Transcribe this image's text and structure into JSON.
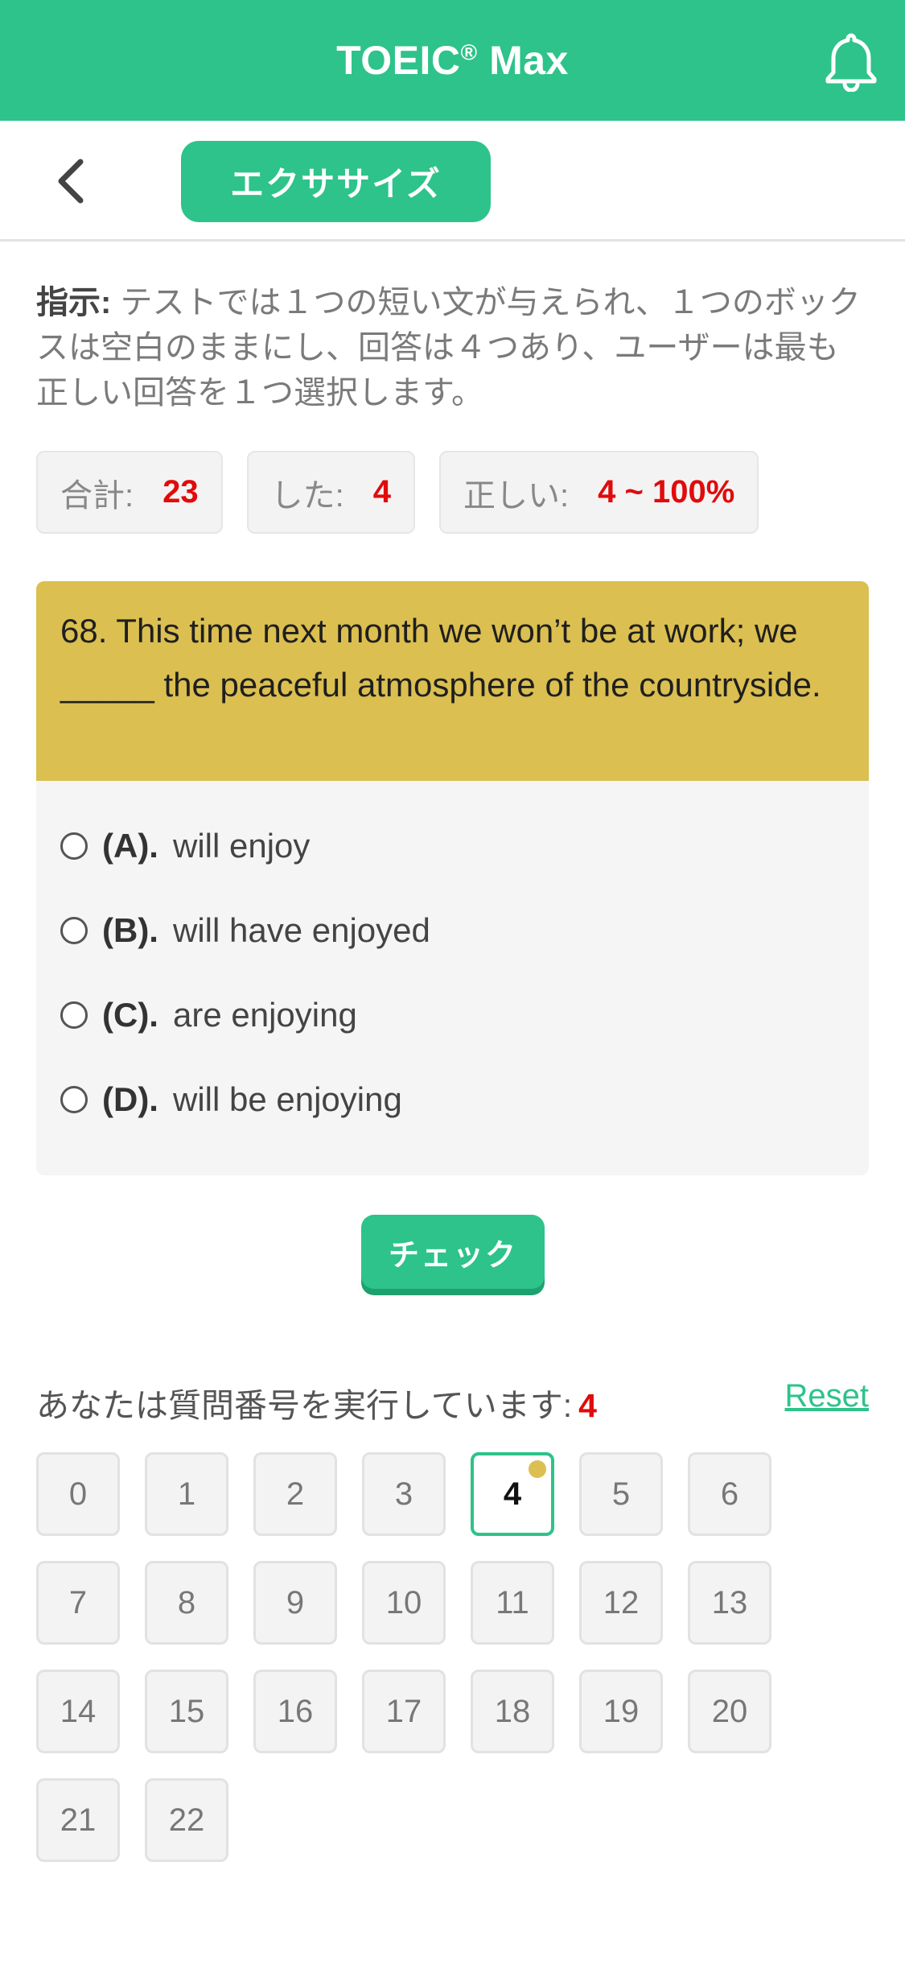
{
  "header": {
    "title": "TOEIC",
    "title_sup": "®",
    "title_suffix": " Max"
  },
  "subheader": {
    "tab_label": "エクササイズ"
  },
  "instruction": {
    "label": "指示:",
    "text": " テストでは１つの短い文が与えられ、１つのボックスは空白のままにし、回答は４つあり、ユーザーは最も正しい回答を１つ選択します。"
  },
  "stats": [
    {
      "label": "合計:",
      "value": "23"
    },
    {
      "label": "した:",
      "value": "4"
    },
    {
      "label": "正しい:",
      "value": "4 ~ 100%"
    }
  ],
  "question": {
    "text": "68. This time next month we won’t be at work; we _____ the peaceful atmosphere of the countryside.",
    "options": [
      {
        "label": "(A).",
        "text": "will enjoy"
      },
      {
        "label": "(B).",
        "text": "will have enjoyed"
      },
      {
        "label": "(C).",
        "text": "are enjoying"
      },
      {
        "label": "(D).",
        "text": "will be enjoying"
      }
    ]
  },
  "check_button": "チェック",
  "progress": {
    "text": "あなたは質問番号を実行しています:",
    "current": "4",
    "reset": "Reset"
  },
  "question_numbers": [
    "0",
    "1",
    "2",
    "3",
    "4",
    "5",
    "6",
    "7",
    "8",
    "9",
    "10",
    "11",
    "12",
    "13",
    "14",
    "15",
    "16",
    "17",
    "18",
    "19",
    "20",
    "21",
    "22"
  ],
  "active_question": "4",
  "colors": {
    "primary": "#2dc38a",
    "question_bg": "#dbbf50",
    "accent_red": "#e10b0b"
  }
}
